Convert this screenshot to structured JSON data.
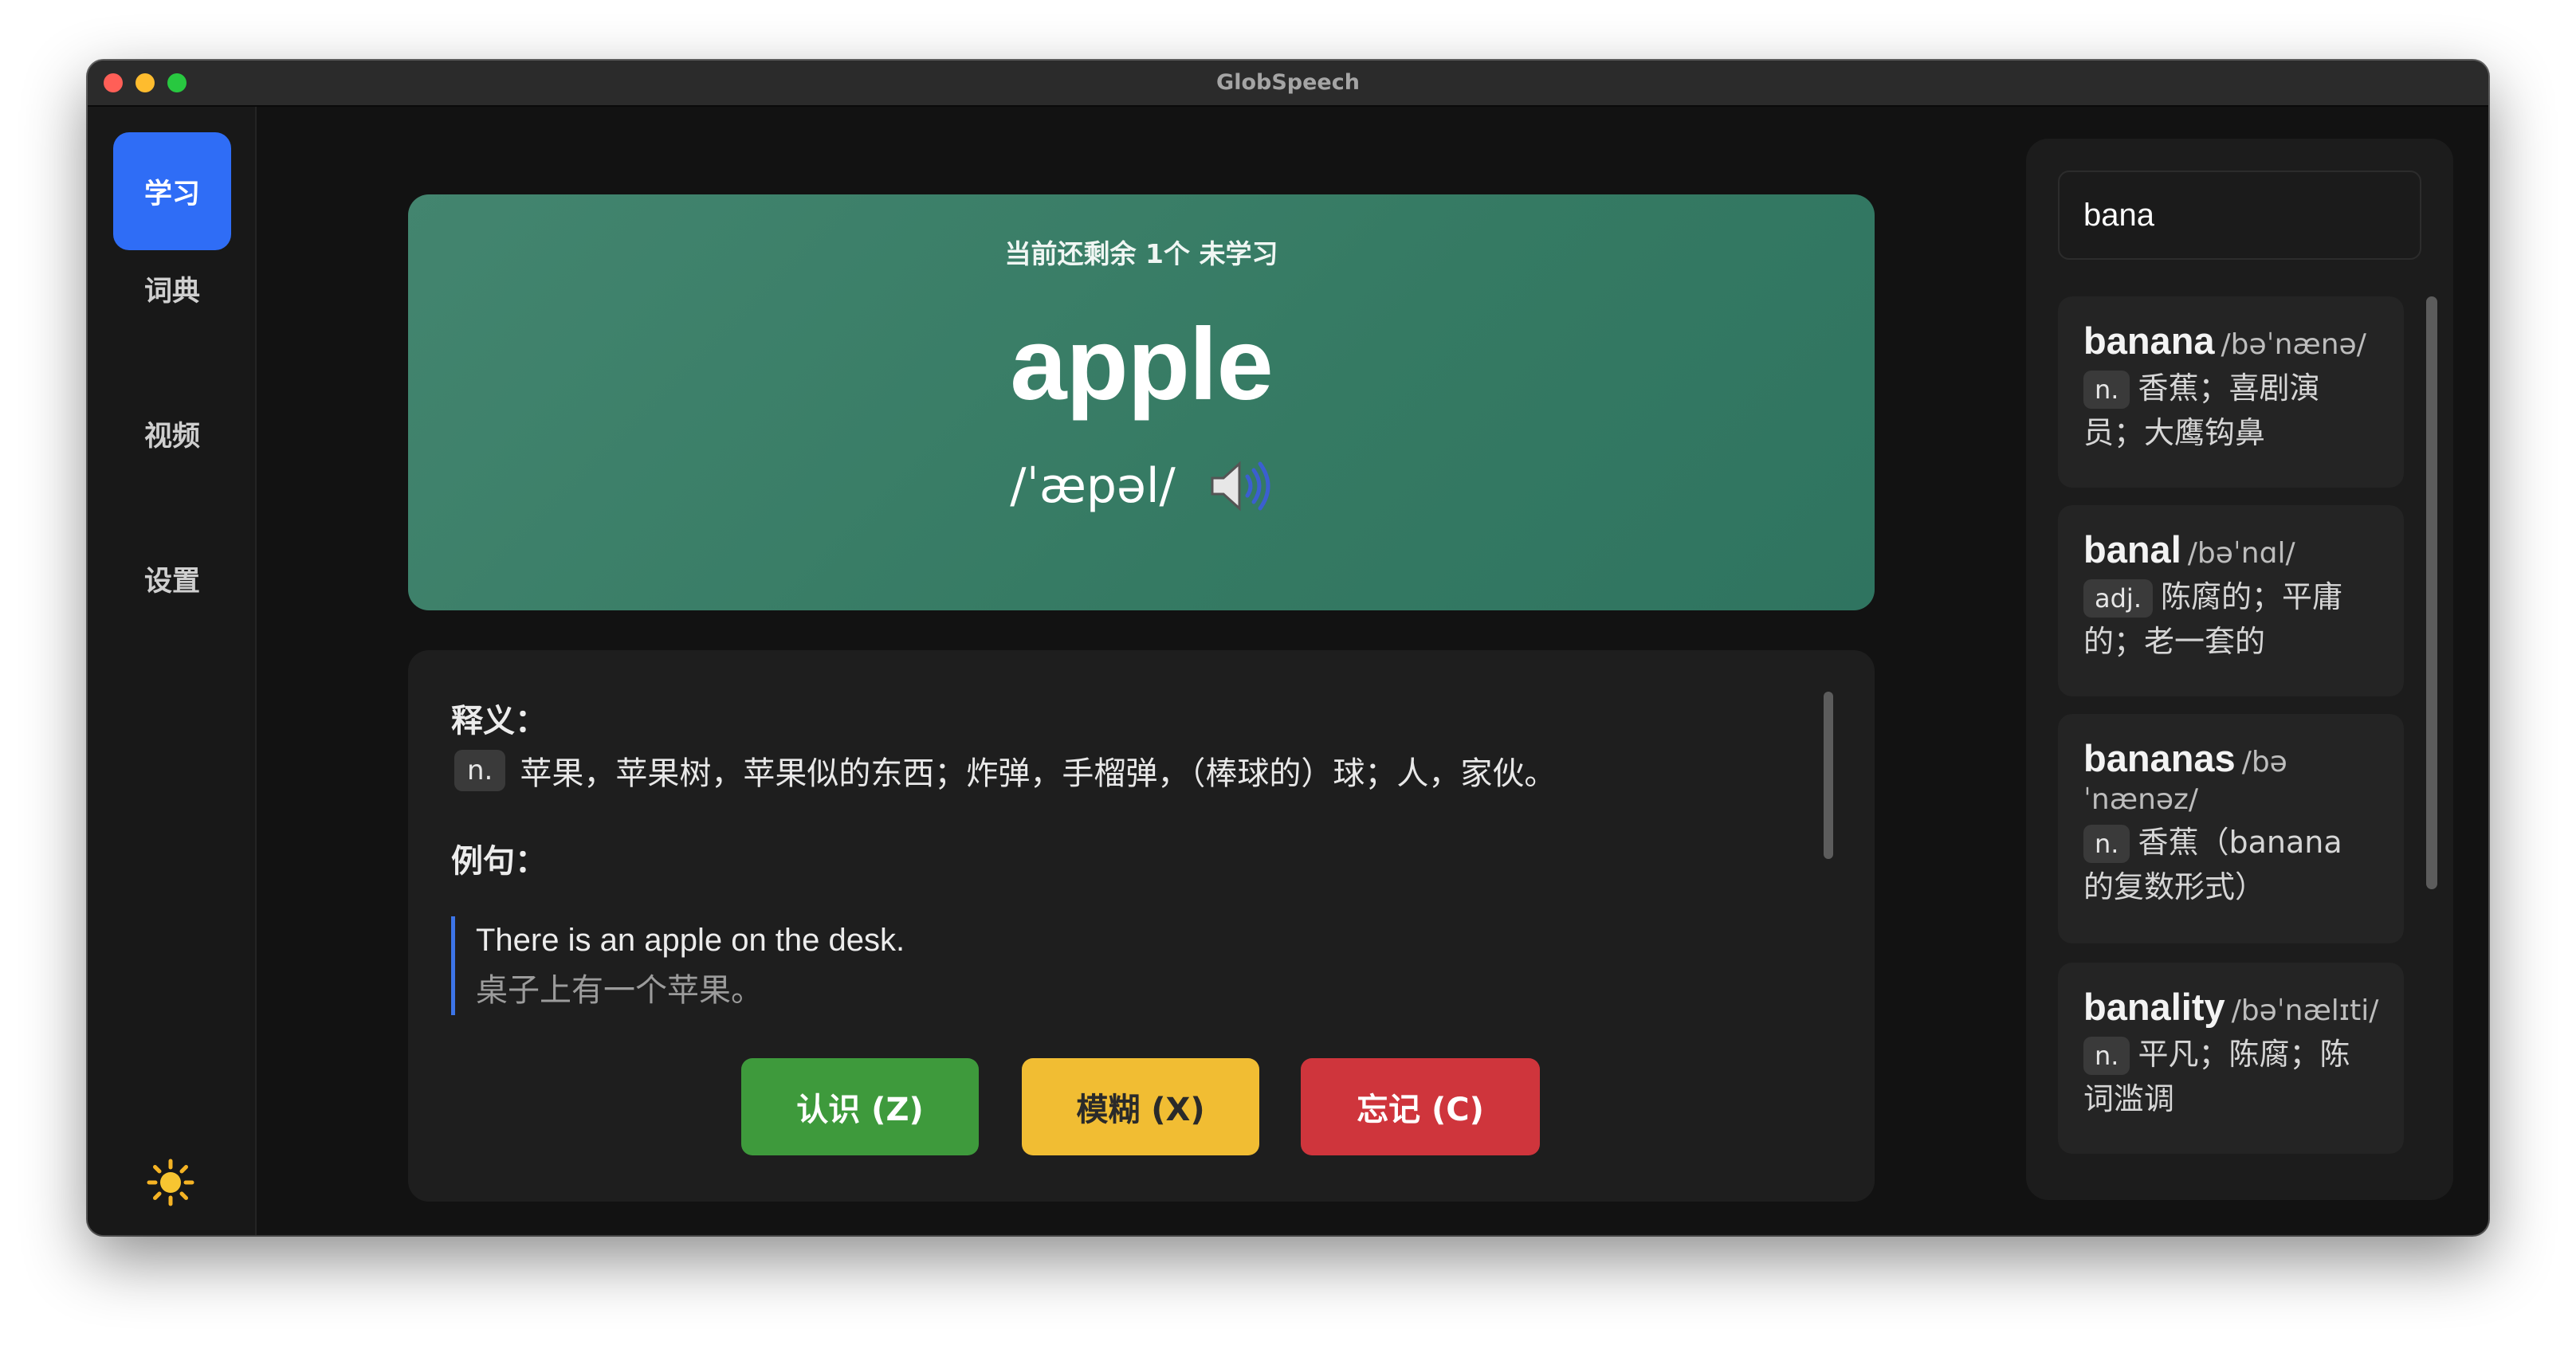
{
  "window": {
    "title": "GlobSpeech"
  },
  "sidebar": {
    "items": [
      {
        "label": "学习",
        "active": true
      },
      {
        "label": "词典",
        "active": false
      },
      {
        "label": "视频",
        "active": false
      },
      {
        "label": "设置",
        "active": false
      }
    ],
    "theme_icon": "sun-icon"
  },
  "card": {
    "remaining": "当前还剩余 1个 未学习",
    "word": "apple",
    "phonetic": "/ˈæpəl/",
    "speaker_icon": "speaker-icon"
  },
  "detail": {
    "definition_label": "释义：",
    "pos": "n.",
    "definition": "苹果，苹果树，苹果似的东西；炸弹，手榴弹，（棒球的）球；人，家伙。",
    "example_label": "例句：",
    "example_en": "There is an apple on the desk.",
    "example_zh": "桌子上有一个苹果。"
  },
  "actions": {
    "know": "认识 (Z)",
    "fuzzy": "模糊 (X)",
    "forget": "忘记 (C)"
  },
  "search": {
    "value": "bana",
    "results": [
      {
        "word": "banana",
        "phonetic": "/bəˈnænə/",
        "pos": "n.",
        "definition_line1": "香蕉；喜剧演",
        "definition_line2": "员；大鹰钩鼻"
      },
      {
        "word": "banal",
        "phonetic": "/bəˈnɑl/",
        "pos": "adj.",
        "definition_line1": "陈腐的；平庸",
        "definition_line2": "的；老一套的"
      },
      {
        "word": "bananas",
        "phonetic_line1": "/bə",
        "phonetic_line2": "ˈnænəz/",
        "pos": "n.",
        "definition_line1": "香蕉（banana",
        "definition_line2": "的复数形式）"
      },
      {
        "word": "banality",
        "phonetic": "/bəˈnælɪti/",
        "pos": "n.",
        "definition_line1": "平凡；陈腐；陈",
        "definition_line2": "词滥调"
      }
    ]
  },
  "colors": {
    "accent": "#2f6df6",
    "card_green": "#3d7f69",
    "know": "#3e9a3c",
    "fuzzy": "#f1bd33",
    "forget": "#cf353c"
  }
}
